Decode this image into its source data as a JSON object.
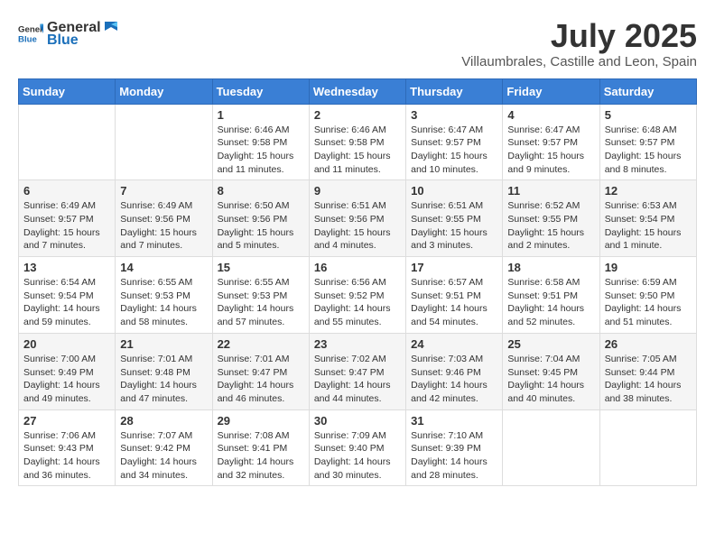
{
  "header": {
    "logo_general": "General",
    "logo_blue": "Blue",
    "month_title": "July 2025",
    "location": "Villaumbrales, Castille and Leon, Spain"
  },
  "weekdays": [
    "Sunday",
    "Monday",
    "Tuesday",
    "Wednesday",
    "Thursday",
    "Friday",
    "Saturday"
  ],
  "weeks": [
    [
      {
        "day": "",
        "sunrise": "",
        "sunset": "",
        "daylight": ""
      },
      {
        "day": "",
        "sunrise": "",
        "sunset": "",
        "daylight": ""
      },
      {
        "day": "1",
        "sunrise": "Sunrise: 6:46 AM",
        "sunset": "Sunset: 9:58 PM",
        "daylight": "Daylight: 15 hours and 11 minutes."
      },
      {
        "day": "2",
        "sunrise": "Sunrise: 6:46 AM",
        "sunset": "Sunset: 9:58 PM",
        "daylight": "Daylight: 15 hours and 11 minutes."
      },
      {
        "day": "3",
        "sunrise": "Sunrise: 6:47 AM",
        "sunset": "Sunset: 9:57 PM",
        "daylight": "Daylight: 15 hours and 10 minutes."
      },
      {
        "day": "4",
        "sunrise": "Sunrise: 6:47 AM",
        "sunset": "Sunset: 9:57 PM",
        "daylight": "Daylight: 15 hours and 9 minutes."
      },
      {
        "day": "5",
        "sunrise": "Sunrise: 6:48 AM",
        "sunset": "Sunset: 9:57 PM",
        "daylight": "Daylight: 15 hours and 8 minutes."
      }
    ],
    [
      {
        "day": "6",
        "sunrise": "Sunrise: 6:49 AM",
        "sunset": "Sunset: 9:57 PM",
        "daylight": "Daylight: 15 hours and 7 minutes."
      },
      {
        "day": "7",
        "sunrise": "Sunrise: 6:49 AM",
        "sunset": "Sunset: 9:56 PM",
        "daylight": "Daylight: 15 hours and 7 minutes."
      },
      {
        "day": "8",
        "sunrise": "Sunrise: 6:50 AM",
        "sunset": "Sunset: 9:56 PM",
        "daylight": "Daylight: 15 hours and 5 minutes."
      },
      {
        "day": "9",
        "sunrise": "Sunrise: 6:51 AM",
        "sunset": "Sunset: 9:56 PM",
        "daylight": "Daylight: 15 hours and 4 minutes."
      },
      {
        "day": "10",
        "sunrise": "Sunrise: 6:51 AM",
        "sunset": "Sunset: 9:55 PM",
        "daylight": "Daylight: 15 hours and 3 minutes."
      },
      {
        "day": "11",
        "sunrise": "Sunrise: 6:52 AM",
        "sunset": "Sunset: 9:55 PM",
        "daylight": "Daylight: 15 hours and 2 minutes."
      },
      {
        "day": "12",
        "sunrise": "Sunrise: 6:53 AM",
        "sunset": "Sunset: 9:54 PM",
        "daylight": "Daylight: 15 hours and 1 minute."
      }
    ],
    [
      {
        "day": "13",
        "sunrise": "Sunrise: 6:54 AM",
        "sunset": "Sunset: 9:54 PM",
        "daylight": "Daylight: 14 hours and 59 minutes."
      },
      {
        "day": "14",
        "sunrise": "Sunrise: 6:55 AM",
        "sunset": "Sunset: 9:53 PM",
        "daylight": "Daylight: 14 hours and 58 minutes."
      },
      {
        "day": "15",
        "sunrise": "Sunrise: 6:55 AM",
        "sunset": "Sunset: 9:53 PM",
        "daylight": "Daylight: 14 hours and 57 minutes."
      },
      {
        "day": "16",
        "sunrise": "Sunrise: 6:56 AM",
        "sunset": "Sunset: 9:52 PM",
        "daylight": "Daylight: 14 hours and 55 minutes."
      },
      {
        "day": "17",
        "sunrise": "Sunrise: 6:57 AM",
        "sunset": "Sunset: 9:51 PM",
        "daylight": "Daylight: 14 hours and 54 minutes."
      },
      {
        "day": "18",
        "sunrise": "Sunrise: 6:58 AM",
        "sunset": "Sunset: 9:51 PM",
        "daylight": "Daylight: 14 hours and 52 minutes."
      },
      {
        "day": "19",
        "sunrise": "Sunrise: 6:59 AM",
        "sunset": "Sunset: 9:50 PM",
        "daylight": "Daylight: 14 hours and 51 minutes."
      }
    ],
    [
      {
        "day": "20",
        "sunrise": "Sunrise: 7:00 AM",
        "sunset": "Sunset: 9:49 PM",
        "daylight": "Daylight: 14 hours and 49 minutes."
      },
      {
        "day": "21",
        "sunrise": "Sunrise: 7:01 AM",
        "sunset": "Sunset: 9:48 PM",
        "daylight": "Daylight: 14 hours and 47 minutes."
      },
      {
        "day": "22",
        "sunrise": "Sunrise: 7:01 AM",
        "sunset": "Sunset: 9:47 PM",
        "daylight": "Daylight: 14 hours and 46 minutes."
      },
      {
        "day": "23",
        "sunrise": "Sunrise: 7:02 AM",
        "sunset": "Sunset: 9:47 PM",
        "daylight": "Daylight: 14 hours and 44 minutes."
      },
      {
        "day": "24",
        "sunrise": "Sunrise: 7:03 AM",
        "sunset": "Sunset: 9:46 PM",
        "daylight": "Daylight: 14 hours and 42 minutes."
      },
      {
        "day": "25",
        "sunrise": "Sunrise: 7:04 AM",
        "sunset": "Sunset: 9:45 PM",
        "daylight": "Daylight: 14 hours and 40 minutes."
      },
      {
        "day": "26",
        "sunrise": "Sunrise: 7:05 AM",
        "sunset": "Sunset: 9:44 PM",
        "daylight": "Daylight: 14 hours and 38 minutes."
      }
    ],
    [
      {
        "day": "27",
        "sunrise": "Sunrise: 7:06 AM",
        "sunset": "Sunset: 9:43 PM",
        "daylight": "Daylight: 14 hours and 36 minutes."
      },
      {
        "day": "28",
        "sunrise": "Sunrise: 7:07 AM",
        "sunset": "Sunset: 9:42 PM",
        "daylight": "Daylight: 14 hours and 34 minutes."
      },
      {
        "day": "29",
        "sunrise": "Sunrise: 7:08 AM",
        "sunset": "Sunset: 9:41 PM",
        "daylight": "Daylight: 14 hours and 32 minutes."
      },
      {
        "day": "30",
        "sunrise": "Sunrise: 7:09 AM",
        "sunset": "Sunset: 9:40 PM",
        "daylight": "Daylight: 14 hours and 30 minutes."
      },
      {
        "day": "31",
        "sunrise": "Sunrise: 7:10 AM",
        "sunset": "Sunset: 9:39 PM",
        "daylight": "Daylight: 14 hours and 28 minutes."
      },
      {
        "day": "",
        "sunrise": "",
        "sunset": "",
        "daylight": ""
      },
      {
        "day": "",
        "sunrise": "",
        "sunset": "",
        "daylight": ""
      }
    ]
  ]
}
